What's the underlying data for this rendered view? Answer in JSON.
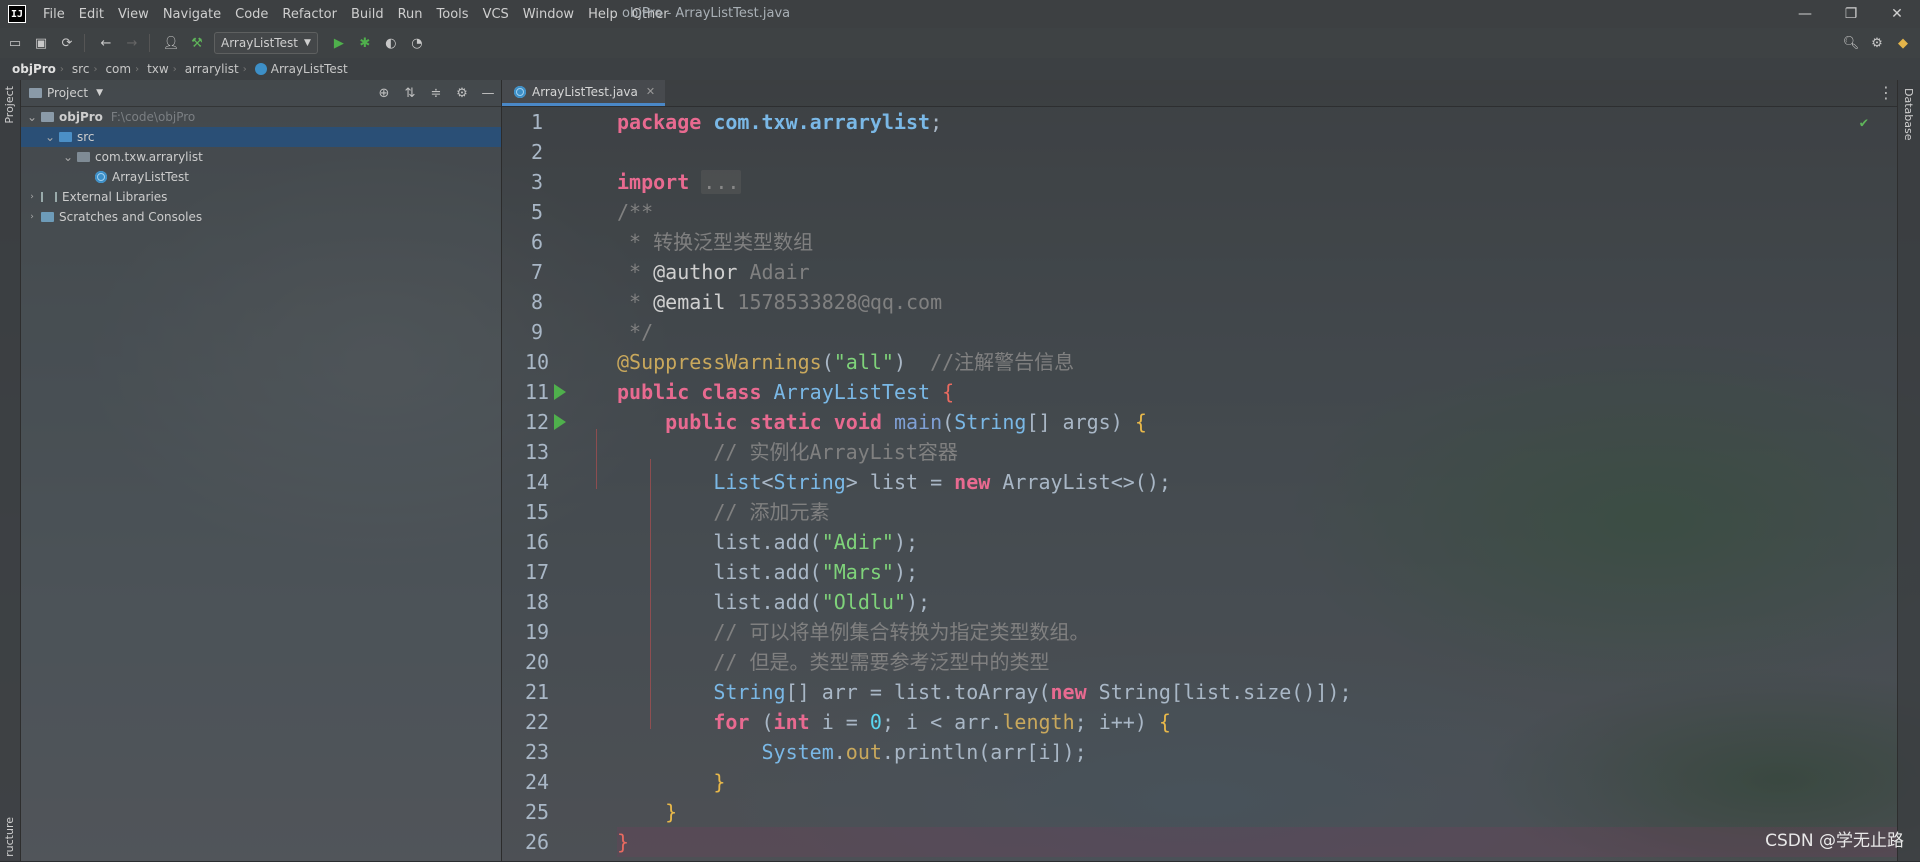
{
  "window": {
    "logo": "IJ",
    "title": "objPro - ArrayListTest.java",
    "controls": [
      "—",
      "❐",
      "✕"
    ]
  },
  "menu": [
    "File",
    "Edit",
    "View",
    "Navigate",
    "Code",
    "Refactor",
    "Build",
    "Run",
    "Tools",
    "VCS",
    "Window",
    "Help",
    "Other"
  ],
  "toolbar": {
    "run_config": "ArrayListTest"
  },
  "breadcrumbs": [
    "objPro",
    "src",
    "com",
    "txw",
    "arrarylist",
    "ArrayListTest"
  ],
  "side_tabs": {
    "left_top": "Project",
    "left_bottom": "ructure",
    "right_top": "Database"
  },
  "project_panel": {
    "title": "Project",
    "tree": [
      {
        "label": "objPro",
        "hint": "F:\\code\\objPro",
        "depth": 0,
        "expanded": true,
        "icon": "folder",
        "selected": false
      },
      {
        "label": "src",
        "hint": "",
        "depth": 1,
        "expanded": true,
        "icon": "folder-blue",
        "selected": true
      },
      {
        "label": "com.txw.arrarylist",
        "hint": "",
        "depth": 2,
        "expanded": true,
        "icon": "package",
        "selected": false
      },
      {
        "label": "ArrayListTest",
        "hint": "",
        "depth": 3,
        "expanded": false,
        "icon": "class",
        "selected": false
      },
      {
        "label": "External Libraries",
        "hint": "",
        "depth": 0,
        "expanded": false,
        "icon": "library",
        "selected": false
      },
      {
        "label": "Scratches and Consoles",
        "hint": "",
        "depth": 0,
        "expanded": false,
        "icon": "scratch",
        "selected": false
      }
    ]
  },
  "editor": {
    "tab": "ArrayListTest.java",
    "line_numbers": [
      1,
      2,
      3,
      5,
      6,
      7,
      8,
      9,
      10,
      11,
      12,
      13,
      14,
      15,
      16,
      17,
      18,
      19,
      20,
      21,
      22,
      23,
      24,
      25,
      26
    ],
    "run_markers": [
      11,
      12
    ]
  },
  "watermark": "CSDN @学无止路",
  "colors": {
    "keyword": "#e86a90",
    "string": "#7fd37a",
    "comment": "#808080",
    "type": "#7ab8e6",
    "selection": "#26507e",
    "run_green": "#4fb04c"
  }
}
